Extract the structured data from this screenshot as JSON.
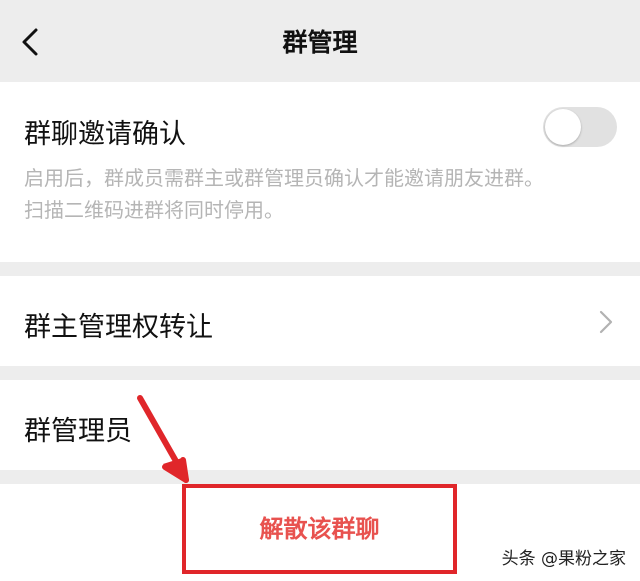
{
  "header": {
    "title": "群管理",
    "back_icon": "chevron-left-icon"
  },
  "invite_confirm": {
    "label": "群聊邀请确认",
    "description_line1": "启用后，群成员需群主或群管理员确认才能邀请朋友进群。",
    "description_line2": "扫描二维码进群将同时停用。",
    "enabled": false
  },
  "transfer_owner": {
    "label": "群主管理权转让",
    "chevron_icon": "chevron-right-icon"
  },
  "admins": {
    "label": "群管理员"
  },
  "disband": {
    "label": "解散该群聊"
  },
  "annotation": {
    "color": "#e0262a"
  },
  "watermark": {
    "text": "头条 @果粉之家"
  }
}
